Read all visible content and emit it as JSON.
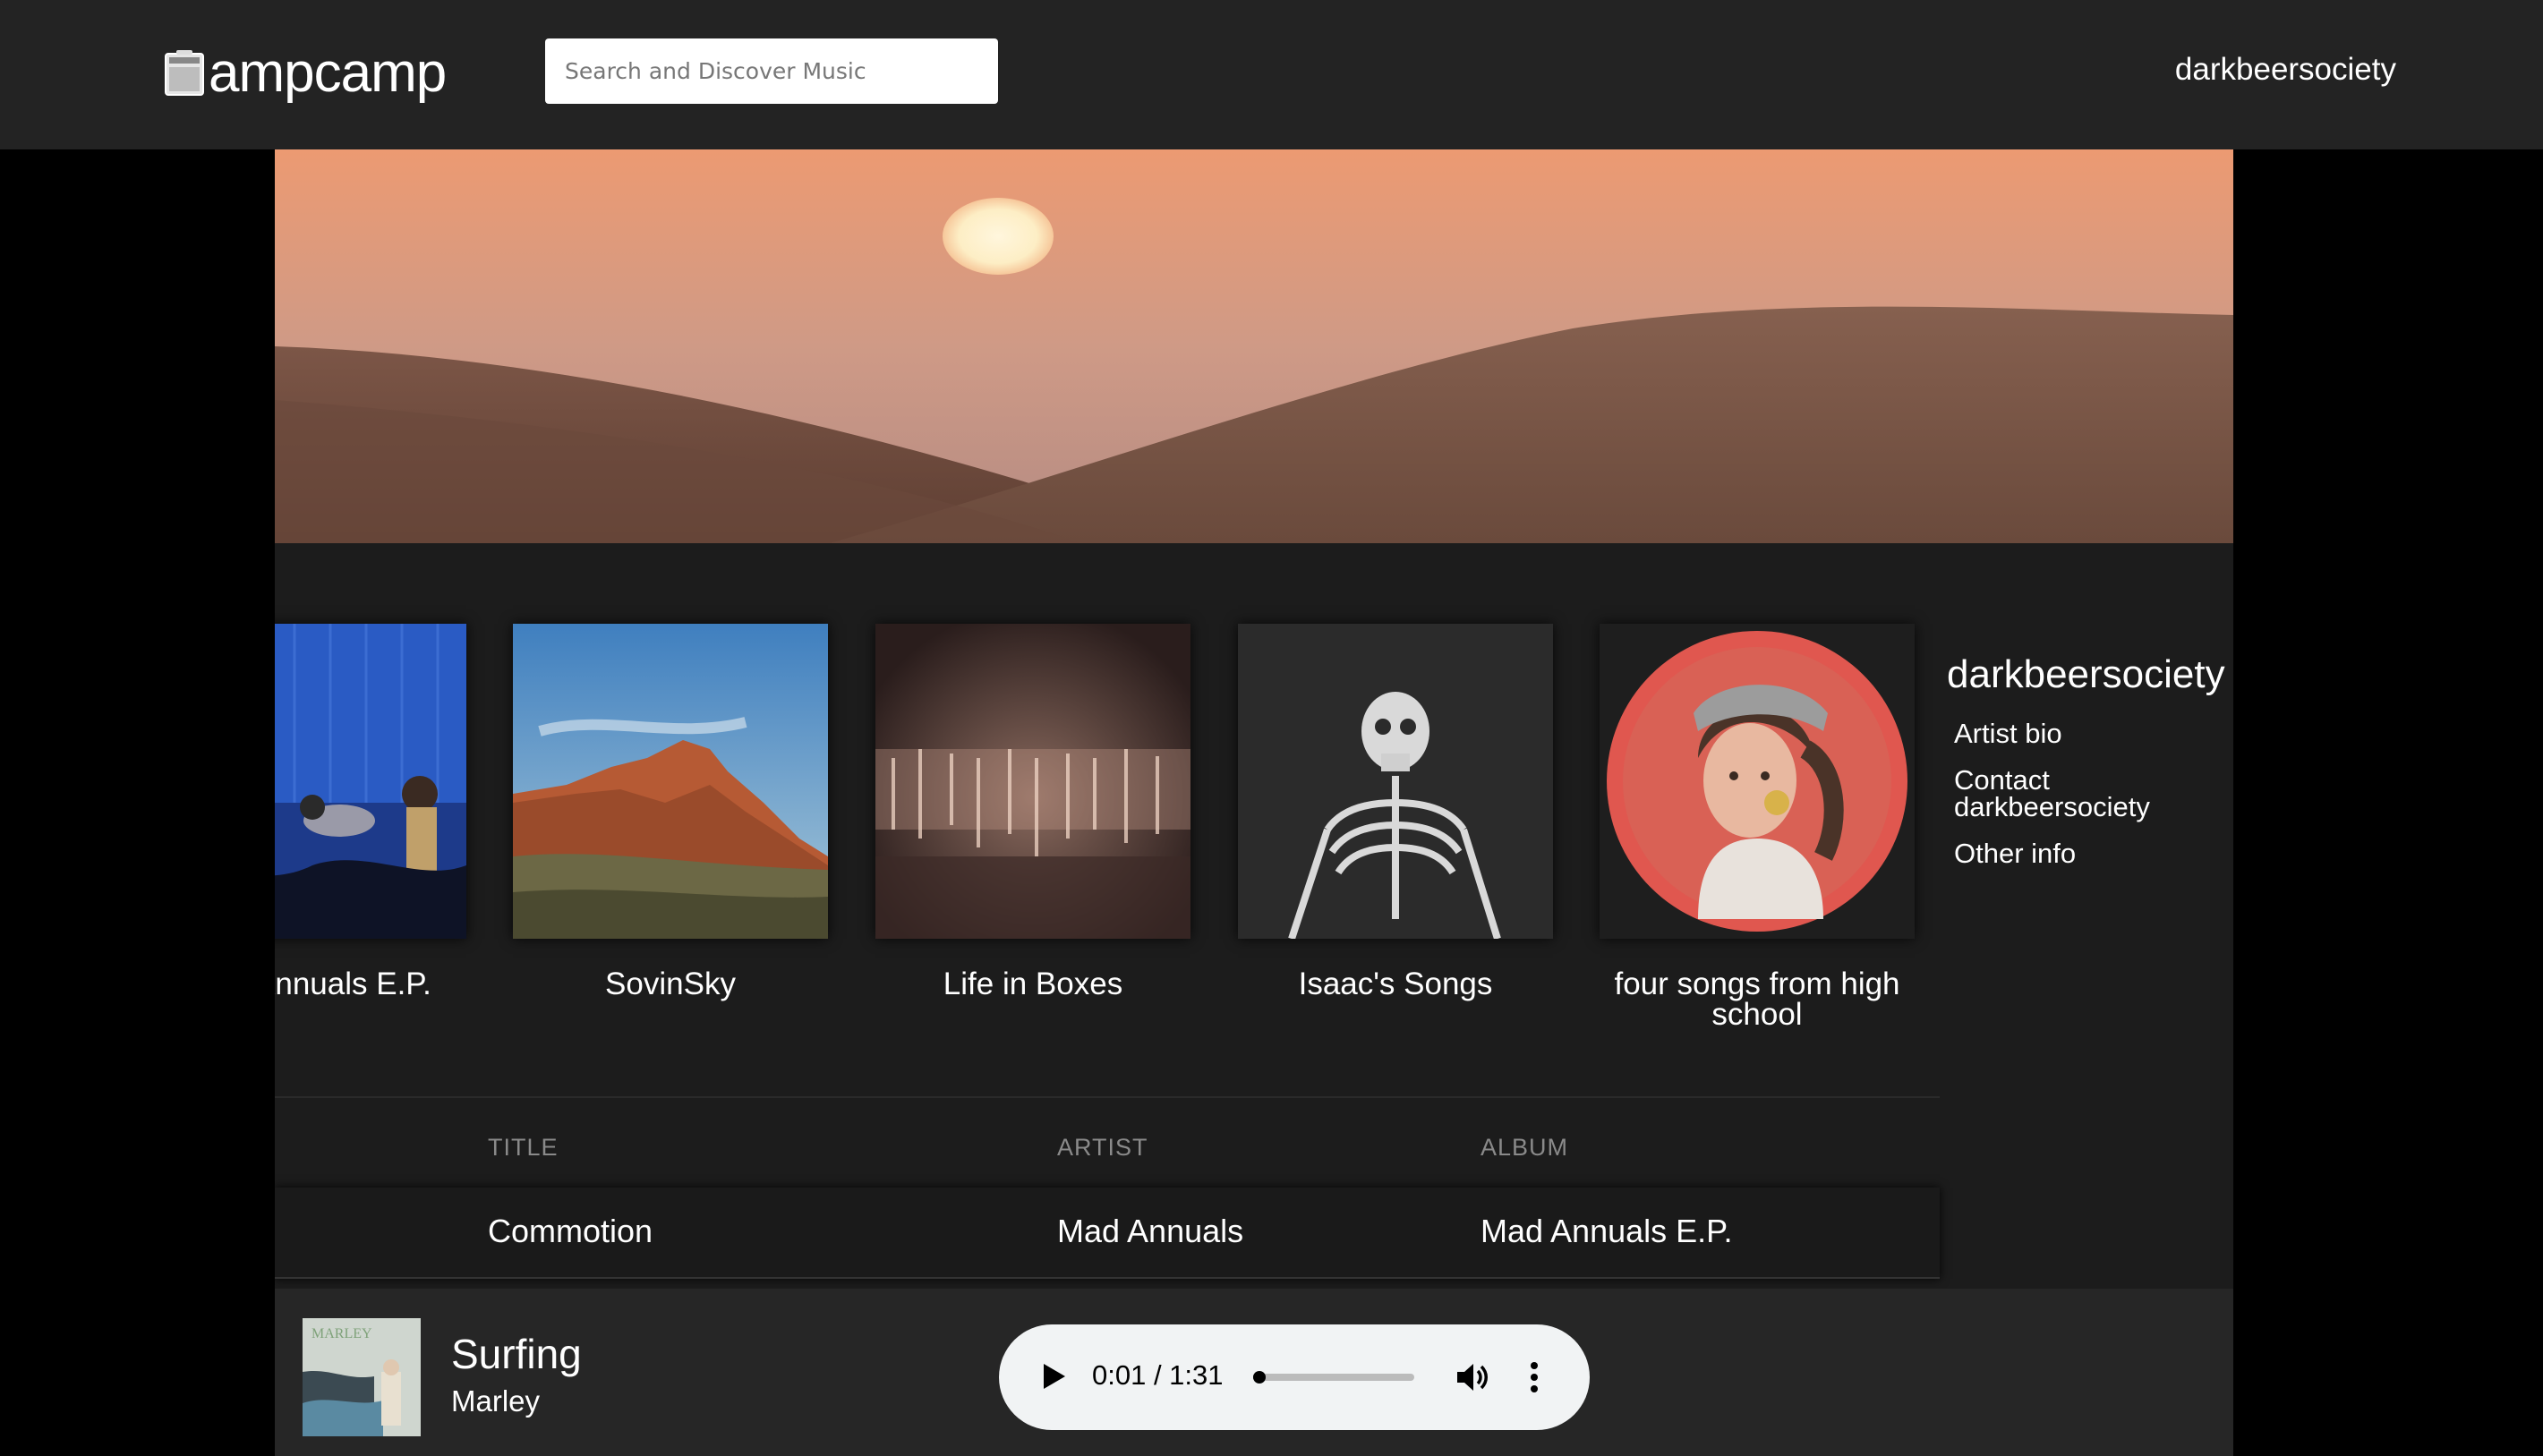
{
  "header": {
    "logo_text": "ampcamp",
    "search_placeholder": "Search and Discover Music",
    "user_link": "darkbeersociety"
  },
  "albums": [
    {
      "title": "Mad Annuals E.P."
    },
    {
      "title": "SovinSky"
    },
    {
      "title": "Life in Boxes"
    },
    {
      "title": "Isaac's Songs"
    },
    {
      "title": "four songs from high school"
    }
  ],
  "sidebar": {
    "artist_name": "darkbeersociety",
    "links": [
      "Artist bio",
      "Contact darkbeersociety",
      "Other info"
    ]
  },
  "tracks": {
    "headers": [
      "TITLE",
      "ARTIST",
      "ALBUM"
    ],
    "rows": [
      {
        "title": "Commotion",
        "artist": "Mad Annuals",
        "album": "Mad Annuals E.P."
      }
    ]
  },
  "now_playing": {
    "title": "Surfing",
    "artist": "Marley",
    "cover_text": "MARLEY",
    "time": "0:01 / 1:31",
    "progress": 0.011
  },
  "colors": {
    "header_bg": "#232323",
    "panel_bg": "#1c1c1c",
    "player_bg": "#262626",
    "accent": "#ffffff"
  },
  "icons": [
    "amp-icon",
    "play-icon",
    "volume-icon",
    "more-icon"
  ]
}
